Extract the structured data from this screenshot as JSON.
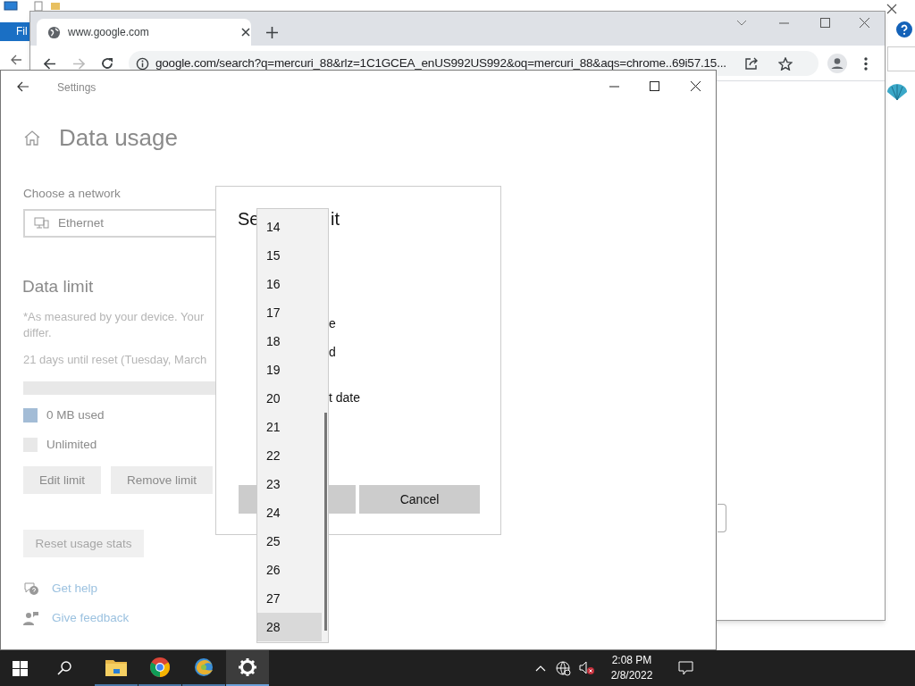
{
  "explorer": {
    "tab": "Fil"
  },
  "browser": {
    "tab_title": "www.google.com",
    "url": "google.com/search?q=mercuri_88&rlz=1C1GCEA_enUS992US992&oq=mercuri_88&aqs=chrome..69i57.15..."
  },
  "settings": {
    "title": "Settings",
    "heading": "Data usage",
    "network_label": "Choose a network",
    "network": "Ethernet",
    "section": "Data limit",
    "note": "*As measured by your device. Your",
    "note_2": "differ.",
    "reset_info": "21 days until reset (Tuesday, March",
    "legend": [
      {
        "label": "0 MB used",
        "color": "#a3bcd6"
      },
      {
        "label": "Unlimited",
        "color": "#e8e8e8"
      }
    ],
    "buttons": [
      "Edit limit",
      "Remove limit"
    ],
    "reset_button": {
      "label": "Reset usage stats",
      "disabled": true
    },
    "links": [
      {
        "label": "Get help",
        "kind": "help"
      },
      {
        "label": "Give feedback",
        "kind": "feedback"
      }
    ]
  },
  "dialog": {
    "title_start": "Se",
    "title_end": "it",
    "fragments": [
      "e",
      "d",
      "t date"
    ],
    "cancel": "Cancel"
  },
  "dropdown": {
    "items": [
      {
        "label": "14",
        "selected": false
      },
      {
        "label": "15",
        "selected": false
      },
      {
        "label": "16",
        "selected": false
      },
      {
        "label": "17",
        "selected": false
      },
      {
        "label": "18",
        "selected": false
      },
      {
        "label": "19",
        "selected": false
      },
      {
        "label": "20",
        "selected": false
      },
      {
        "label": "21",
        "selected": false
      },
      {
        "label": "22",
        "selected": false
      },
      {
        "label": "23",
        "selected": false
      },
      {
        "label": "24",
        "selected": false
      },
      {
        "label": "25",
        "selected": false
      },
      {
        "label": "26",
        "selected": false
      },
      {
        "label": "27",
        "selected": false
      },
      {
        "label": "28",
        "selected": true
      }
    ]
  },
  "taskbar": {
    "apps": [
      {
        "kind": "folder",
        "selected": false
      },
      {
        "kind": "chrome",
        "selected": false
      },
      {
        "kind": "browser",
        "selected": false
      },
      {
        "kind": "settings",
        "selected": true
      }
    ],
    "time": "2:08 PM",
    "date": "2/8/2022"
  }
}
